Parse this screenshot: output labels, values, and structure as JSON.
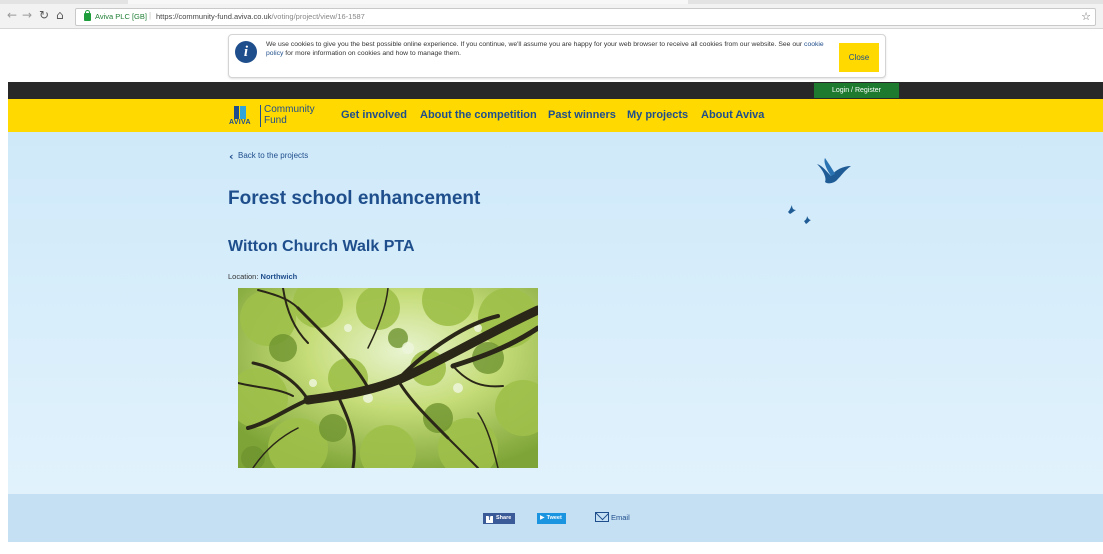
{
  "browser": {
    "back_icon": "back-arrow-icon",
    "forward_icon": "forward-arrow-icon",
    "reload_icon": "reload-icon",
    "home_icon": "home-icon",
    "secure_org": "Aviva PLC [GB]",
    "url_host": "https://community-fund.aviva.co.uk",
    "url_path": "/voting/project/view/16-1587",
    "star_icon": "star-icon"
  },
  "cookie_banner": {
    "text_before_link": "We use cookies to give you the best possible online experience. If you continue, we'll assume you are happy for your web browser to receive all cookies from our website. See our",
    "link_text": "cookie policy",
    "text_after_link": "for more information on cookies and how to manage them.",
    "close_label": "Close"
  },
  "top_bar": {
    "login_label": "Login / Register"
  },
  "nav": {
    "logo_word": "AVIVA",
    "logo_line1": "Community",
    "logo_line2": "Fund",
    "items": [
      {
        "label": "Get involved"
      },
      {
        "label": "About the competition"
      },
      {
        "label": "Past winners"
      },
      {
        "label": "My projects"
      },
      {
        "label": "About Aviva"
      }
    ]
  },
  "project": {
    "back_label": "Back to the projects",
    "title": "Forest school enhancement",
    "organisation": "Witton Church Walk PTA",
    "location_label": "Location:",
    "location_value": "Northwich"
  },
  "share": {
    "facebook_label": "Share",
    "twitter_label": "Tweet",
    "email_label": "Email"
  },
  "colors": {
    "brand_yellow": "#ffd900",
    "brand_blue": "#1f4e8c",
    "login_green": "#1e7a2e",
    "content_bg": "#d6ecfa"
  }
}
